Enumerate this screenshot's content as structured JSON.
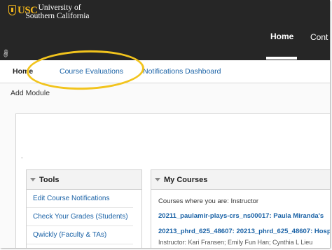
{
  "header": {
    "logo_abbrev": "USC",
    "logo_line1": "University of",
    "logo_line2": "Southern California",
    "nav": {
      "home": "Home",
      "content": "Cont"
    }
  },
  "tabs": [
    {
      "label": "Home"
    },
    {
      "label": "Course Evaluations"
    },
    {
      "label": "Notifications Dashboard"
    }
  ],
  "add_module": "Add Module",
  "dot": ".",
  "tools": {
    "title": "Tools",
    "items": [
      "Edit Course Notifications",
      "Check Your Grades (Students)",
      "Qwickly (Faculty & TAs)"
    ]
  },
  "my_courses": {
    "title": "My Courses",
    "label": "Courses where you are: Instructor",
    "courses": [
      "20211_paulamir-plays-crs_ns00017: Paula Miranda's",
      "20213_phrd_625_48607: 20213_phrd_625_48607: Hospi"
    ],
    "instructor_line": "Instructor: Kari Fransen; Emily Fun Han; Cynthia L Lieu"
  },
  "colors": {
    "header_bg": "#262626",
    "brand_gold": "#f1b51c",
    "link_blue": "#1a62a6",
    "highlight": "#f2c41d"
  },
  "icons": {
    "link": "link-icon",
    "collapse": "triangle-down-icon"
  }
}
